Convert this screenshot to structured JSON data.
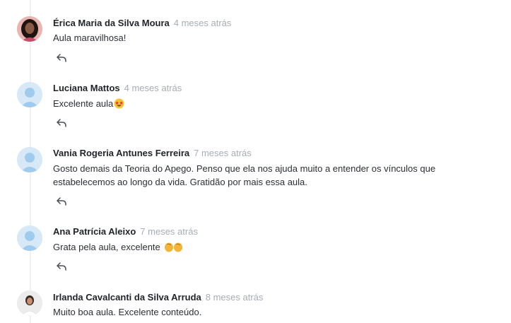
{
  "comments": [
    {
      "author": "Érica Maria da Silva Moura",
      "time": "4 meses atrás",
      "text": "Aula maravilhosa!",
      "avatar": "photo"
    },
    {
      "author": "Luciana Mattos",
      "time": "4 meses atrás",
      "text": "Excelente aula",
      "emoji": "star-struck-face",
      "avatar": "default-user"
    },
    {
      "author": "Vania Rogeria Antunes Ferreira",
      "time": "7 meses atrás",
      "text": "Gosto demais da Teoria do Apego. Penso que ela nos ajuda muito a entender os vínculos que estabelecemos ao longo da vida. Gratidão por mais essa aula.",
      "avatar": "default-user"
    },
    {
      "author": "Ana Patrícia Aleixo",
      "time": "7 meses atrás",
      "text": "Grata pela aula, excelente ",
      "emoji": "clapping-hands",
      "avatar": "default-user"
    },
    {
      "author": "Irlanda Cavalcanti da Silva Arruda",
      "time": "8 meses atrás",
      "text": "Muito boa aula. Excelente conteúdo.",
      "avatar": "photo"
    }
  ],
  "icons": {
    "reply": "reply-arrow-icon"
  },
  "colors": {
    "author": "#1f2329",
    "time": "#a7adb6",
    "avatar_bg": "#d7e8f6",
    "avatar_fg": "#9fcbee"
  }
}
